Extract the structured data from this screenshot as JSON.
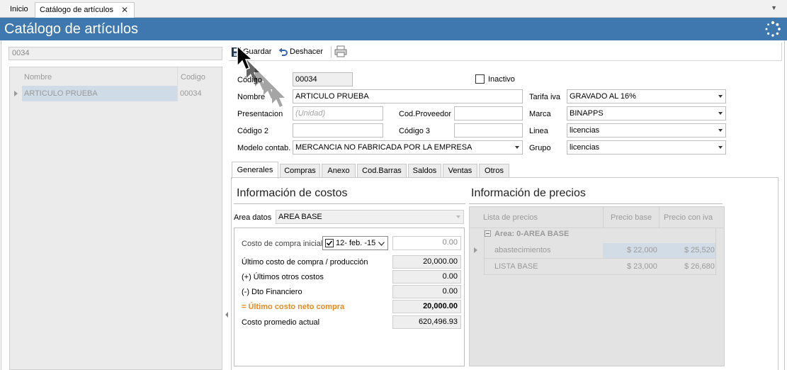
{
  "tabs": {
    "inicio": "Inicio",
    "catalogo": "Catálogo de artículos",
    "close_glyph": "✕"
  },
  "titlebar": {
    "title": "Catálogo de artículos"
  },
  "left": {
    "search_value": "0034",
    "grid": {
      "columns": [
        "Nombre",
        "Codigo"
      ],
      "rows": [
        {
          "nombre": "ARTICULO PRUEBA",
          "codigo": "00034"
        }
      ]
    }
  },
  "toolbar": {
    "guardar": "Guardar",
    "deshacer": "Deshacer",
    "icons": [
      "save-icon",
      "undo-icon",
      "print-icon"
    ]
  },
  "form": {
    "codigo_label": "Código",
    "codigo_value": "00034",
    "inactivo_label": "Inactivo",
    "inactivo_checked": false,
    "nombre_label": "Nombre",
    "nombre_value": "ARTICULO PRUEBA",
    "tarifa_label": "Tarifa iva",
    "tarifa_value": "GRAVADO AL 16%",
    "presentacion_label": "Presentacion",
    "presentacion_placeholder": "(Unidad)",
    "codprov_label": "Cod.Proveedor",
    "codprov_value": "",
    "marca_label": "Marca",
    "marca_value": "BINAPPS",
    "codigo2_label": "Código 2",
    "codigo2_value": "",
    "codigo3_label": "Código 3",
    "codigo3_value": "",
    "linea_label": "Linea",
    "linea_value": "licencias",
    "modelo_label": "Modelo contab.",
    "modelo_value": "MERCANCIA NO FABRICADA POR LA EMPRESA",
    "grupo_label": "Grupo",
    "grupo_value": "licencias"
  },
  "inner_tabs": [
    "Generales",
    "Compras",
    "Anexo",
    "Cod.Barras",
    "Saldos",
    "Ventas",
    "Otros"
  ],
  "costos": {
    "title": "Información de costos",
    "area_label": "Area datos",
    "area_value": "AREA BASE",
    "costo_inicial_label": "Costo de compra inicial",
    "costo_inicial_date": "12- feb. -15",
    "costo_inicial_checked": true,
    "costo_inicial_value": "0.00",
    "ultimo_costo_label": "Último costo de compra / producción",
    "ultimo_costo_value": "20,000.00",
    "otros_label": "(+) Últimos otros costos",
    "otros_value": "0.00",
    "dto_label": "(-) Dto Financiero",
    "dto_value": "0.00",
    "neto_label": "= Último costo neto compra",
    "neto_value": "20,000.00",
    "promedio_label": "Costo promedio actual",
    "promedio_value": "620,496.93"
  },
  "precios": {
    "title": "Información de precios",
    "columns": [
      "Lista de precios",
      "Precio base",
      "Precio con iva"
    ],
    "group_label": "Area: 0-AREA BASE",
    "rows": [
      {
        "lista": "abastecimientos",
        "base": "$ 22,000",
        "iva": "$ 25,520"
      },
      {
        "lista": "LISTA BASE",
        "base": "$ 23,000",
        "iva": "$ 26,680"
      }
    ]
  },
  "colors": {
    "titlebar": "#3e78ae",
    "accent_orange": "#e98a1e",
    "selection": "#cfdbe6"
  }
}
